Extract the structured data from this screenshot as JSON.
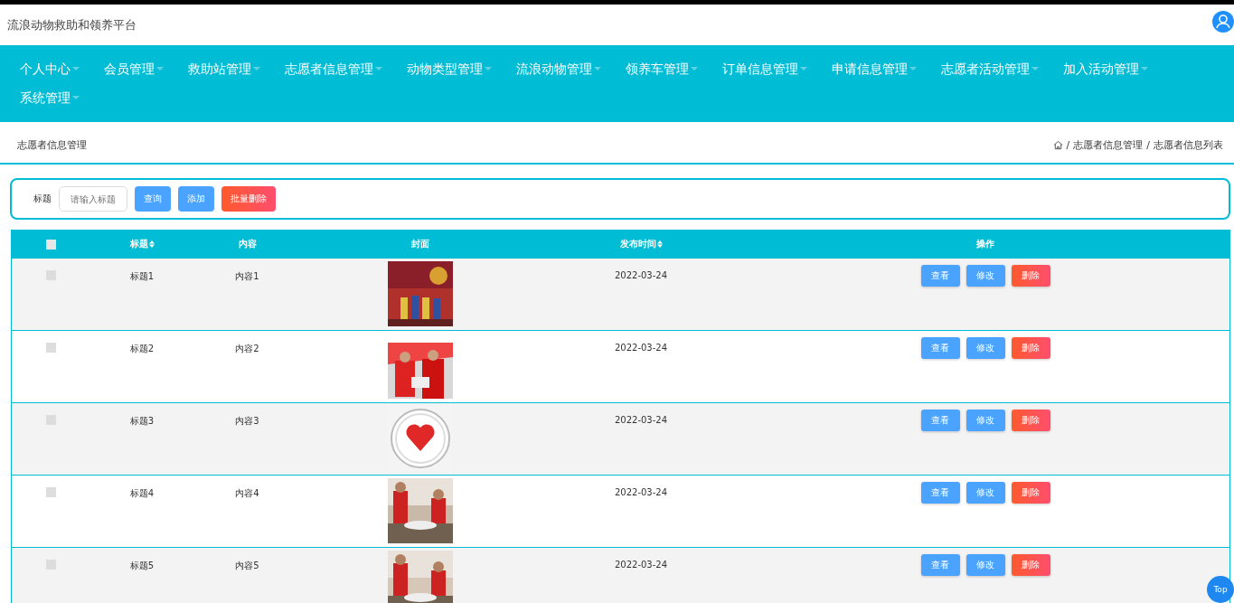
{
  "header": {
    "title": "流浪动物救助和领养平台"
  },
  "nav": {
    "items": [
      {
        "label": "个人中心"
      },
      {
        "label": "会员管理"
      },
      {
        "label": "救助站管理"
      },
      {
        "label": "志愿者信息管理"
      },
      {
        "label": "动物类型管理"
      },
      {
        "label": "流浪动物管理"
      },
      {
        "label": "领养车管理"
      },
      {
        "label": "订单信息管理"
      },
      {
        "label": "申请信息管理"
      },
      {
        "label": "志愿者活动管理"
      },
      {
        "label": "加入活动管理"
      },
      {
        "label": "系统管理"
      }
    ]
  },
  "page_title": "志愿者信息管理",
  "breadcrumb": {
    "separator": "/",
    "items": [
      "志愿者信息管理",
      "志愿者信息列表"
    ]
  },
  "search": {
    "label": "标题",
    "placeholder": "请输入标题",
    "buttons": [
      {
        "label": "查询",
        "kind": "primary"
      },
      {
        "label": "添加",
        "kind": "primary"
      },
      {
        "label": "批量删除",
        "kind": "danger"
      }
    ]
  },
  "table": {
    "select_all_checked": false,
    "columns": [
      {
        "label": "标题",
        "sortable": true
      },
      {
        "label": "内容",
        "sortable": false
      },
      {
        "label": "封面",
        "sortable": false
      },
      {
        "label": "发布时间",
        "sortable": true
      },
      {
        "label": "操作",
        "sortable": false
      }
    ],
    "rows": [
      {
        "checked": false,
        "title": "标题1",
        "content": "内容1",
        "date": "2022-03-24",
        "actions": [
          {
            "label": "查看",
            "kind": "primary"
          },
          {
            "label": "修改",
            "kind": "primary"
          },
          {
            "label": "删除",
            "kind": "danger"
          }
        ]
      },
      {
        "checked": false,
        "title": "标题2",
        "content": "内容2",
        "date": "2022-03-24",
        "actions": [
          {
            "label": "查看",
            "kind": "primary"
          },
          {
            "label": "修改",
            "kind": "primary"
          },
          {
            "label": "删除",
            "kind": "danger"
          }
        ]
      },
      {
        "checked": false,
        "title": "标题3",
        "content": "内容3",
        "date": "2022-03-24",
        "actions": [
          {
            "label": "查看",
            "kind": "primary"
          },
          {
            "label": "修改",
            "kind": "primary"
          },
          {
            "label": "删除",
            "kind": "danger"
          }
        ]
      },
      {
        "checked": false,
        "title": "标题4",
        "content": "内容4",
        "date": "2022-03-24",
        "actions": [
          {
            "label": "查看",
            "kind": "primary"
          },
          {
            "label": "修改",
            "kind": "primary"
          },
          {
            "label": "删除",
            "kind": "danger"
          }
        ]
      },
      {
        "checked": false,
        "title": "标题5",
        "content": "内容5",
        "date": "2022-03-24",
        "actions": [
          {
            "label": "查看",
            "kind": "primary"
          },
          {
            "label": "修改",
            "kind": "primary"
          },
          {
            "label": "删除",
            "kind": "danger"
          }
        ]
      }
    ]
  },
  "back_to_top": {
    "label": "Top"
  }
}
